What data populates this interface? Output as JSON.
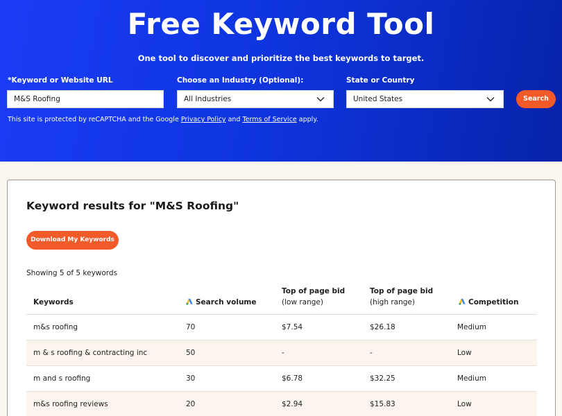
{
  "hero": {
    "title": "Free Keyword Tool",
    "subtitle": "One tool to discover and prioritize the best keywords to target."
  },
  "form": {
    "keyword_label": "*Keyword or Website URL",
    "keyword_value": "M&S Roofing",
    "industry_label": "Choose an Industry (Optional):",
    "industry_value": "All Industries",
    "location_label": "State or Country",
    "location_value": "United States",
    "search_label": "Search"
  },
  "recaptcha": {
    "prefix": "This site is protected by reCAPTCHA and the Google ",
    "privacy_link": "Privacy Policy",
    "middle": " and ",
    "terms_link": "Terms of Service",
    "suffix": " apply."
  },
  "results": {
    "title": "Keyword results for \"M&S Roofing\"",
    "download_label": "Download My Keywords",
    "showing": "Showing 5 of 5 keywords",
    "columns": {
      "keywords": "Keywords",
      "search_volume": "Search volume",
      "bid_low_line1": "Top of page bid",
      "bid_low_line2": "(low range)",
      "bid_high_line1": "Top of page bid",
      "bid_high_line2": "(high range)",
      "competition": "Competition"
    },
    "rows": [
      {
        "keyword": "m&s roofing",
        "volume": "70",
        "low": "$7.54",
        "high": "$26.18",
        "competition": "Medium"
      },
      {
        "keyword": "m & s roofing & contracting inc",
        "volume": "50",
        "low": "-",
        "high": "-",
        "competition": "Low"
      },
      {
        "keyword": "m and s roofing",
        "volume": "30",
        "low": "$6.78",
        "high": "$32.25",
        "competition": "Medium"
      },
      {
        "keyword": "m&s roofing reviews",
        "volume": "20",
        "low": "$2.94",
        "high": "$15.83",
        "competition": "Low"
      }
    ]
  },
  "icons": {
    "dropdown": "chevron-down-icon",
    "google_ads": "google-ads-icon"
  },
  "colors": {
    "hero_blue": "#1a3cf5",
    "accent_orange": "#f25a2a",
    "page_bg": "#fbf6f0"
  }
}
